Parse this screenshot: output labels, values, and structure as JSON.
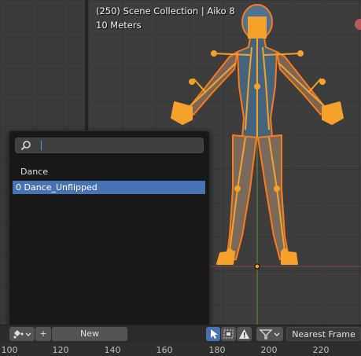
{
  "viewport": {
    "collection_label": "(250) Scene Collection | Aiko 8",
    "scale_label": "10 Meters"
  },
  "popup": {
    "search": {
      "value": "",
      "placeholder": ""
    },
    "items": [
      {
        "label": "Dance",
        "selected": false
      },
      {
        "label": "0 Dance_Unflipped",
        "selected": true
      }
    ]
  },
  "footer": {
    "new_label": "New",
    "plus_label": "+",
    "frame_label": "Nearest Frame",
    "icons": [
      "action-mode-icon",
      "chevron-down-icon",
      "select-cursor-icon",
      "box-select-icon",
      "warning-icon",
      "filter-icon",
      "chevron-down-icon"
    ]
  },
  "ruler": {
    "ticks": [
      "100",
      "120",
      "140",
      "160",
      "180",
      "200",
      "220"
    ]
  },
  "colors": {
    "accent": "#4772b3",
    "bone_orange": "#f5a22c",
    "selection_outline": "#ff7a1a"
  }
}
